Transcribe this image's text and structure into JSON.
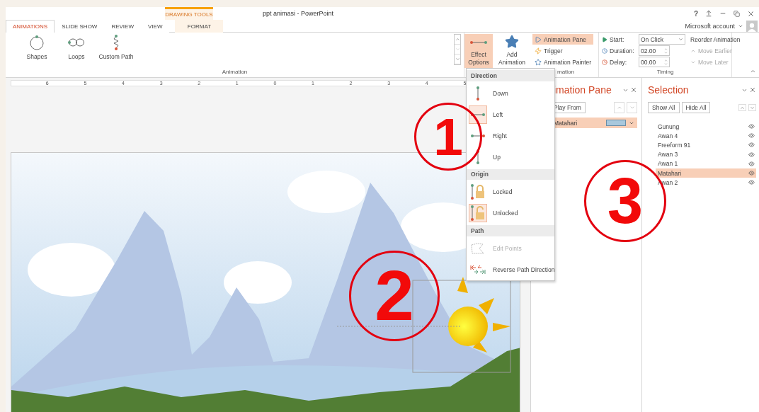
{
  "window": {
    "title": "ppt animasi - PowerPoint",
    "help": "?"
  },
  "contextual_group": {
    "label": "DRAWING TOOLS"
  },
  "tabs": [
    {
      "label": "ANIMATIONS",
      "selected": true,
      "kind": "normal"
    },
    {
      "label": "SLIDE SHOW",
      "selected": false,
      "kind": "normal"
    },
    {
      "label": "REVIEW",
      "selected": false,
      "kind": "normal"
    },
    {
      "label": "VIEW",
      "selected": false,
      "kind": "normal"
    },
    {
      "label": "FORMAT",
      "selected": false,
      "kind": "contextual"
    }
  ],
  "account": {
    "label": "Microsoft account"
  },
  "ribbon": {
    "gallery": [
      {
        "label": "Shapes",
        "kind": "shapes"
      },
      {
        "label": "Loops",
        "kind": "loops"
      },
      {
        "label": "Custom Path",
        "kind": "custom"
      }
    ],
    "animation_group_label": "Animation",
    "effect_options": {
      "label": "Effect Options",
      "selected": true
    },
    "add_animation": {
      "label": "Add Animation"
    },
    "advanced": [
      {
        "label": "Animation Pane",
        "kind": "pane",
        "selected": true
      },
      {
        "label": "Trigger",
        "kind": "trigger",
        "selected": false
      },
      {
        "label": "Animation Painter",
        "kind": "painter",
        "selected": false
      }
    ],
    "advanced_group_label": "mation",
    "timing": {
      "start_label": "Start:",
      "start_value": "On Click",
      "duration_label": "Duration:",
      "duration_value": "02.00",
      "delay_label": "Delay:",
      "delay_value": "00.00",
      "group_label": "Timing"
    },
    "reorder": {
      "title": "Reorder Animation",
      "buttons": [
        {
          "label": "Move Earlier",
          "kind": "up",
          "disabled": true
        },
        {
          "label": "Move Later",
          "kind": "down",
          "disabled": true
        }
      ]
    }
  },
  "ruler": {
    "labels": [
      "6",
      "5",
      "4",
      "3",
      "2",
      "1",
      "0",
      "1",
      "2",
      "3",
      "4",
      "5"
    ]
  },
  "effect_menu": {
    "sections": [
      {
        "title": "Direction",
        "items": [
          {
            "label": "Down",
            "kind": "down",
            "selected": false,
            "disabled": false
          },
          {
            "label": "Left",
            "kind": "left",
            "selected": true,
            "disabled": false
          },
          {
            "label": "Right",
            "kind": "right",
            "selected": false,
            "disabled": false
          },
          {
            "label": "Up",
            "kind": "up",
            "selected": false,
            "disabled": false
          }
        ]
      },
      {
        "title": "Origin",
        "items": [
          {
            "label": "Locked",
            "kind": "locked",
            "selected": false,
            "disabled": false
          },
          {
            "label": "Unlocked",
            "kind": "unlocked",
            "selected": true,
            "disabled": false
          }
        ]
      },
      {
        "title": "Path",
        "items": [
          {
            "label": "Edit Points",
            "kind": "edit",
            "selected": false,
            "disabled": true
          },
          {
            "label": "Reverse Path Direction",
            "kind": "reverse",
            "selected": false,
            "disabled": false
          }
        ]
      }
    ]
  },
  "animation_pane": {
    "title": "imation Pane",
    "play_button": "Play From",
    "items": [
      {
        "label": "Matahari",
        "selected": true
      }
    ]
  },
  "selection_pane": {
    "title": "Selection",
    "buttons": [
      "Show All",
      "Hide All"
    ],
    "items": [
      {
        "label": "Gunung",
        "selected": false
      },
      {
        "label": "Awan 4",
        "selected": false
      },
      {
        "label": "Freeform 91",
        "selected": false
      },
      {
        "label": "Awan 3",
        "selected": false
      },
      {
        "label": "Awan 1",
        "selected": false
      },
      {
        "label": "Matahari",
        "selected": true
      },
      {
        "label": "Awan 2",
        "selected": false
      }
    ]
  },
  "annotations": [
    {
      "label": "1"
    },
    {
      "label": "2"
    },
    {
      "label": "3"
    }
  ]
}
